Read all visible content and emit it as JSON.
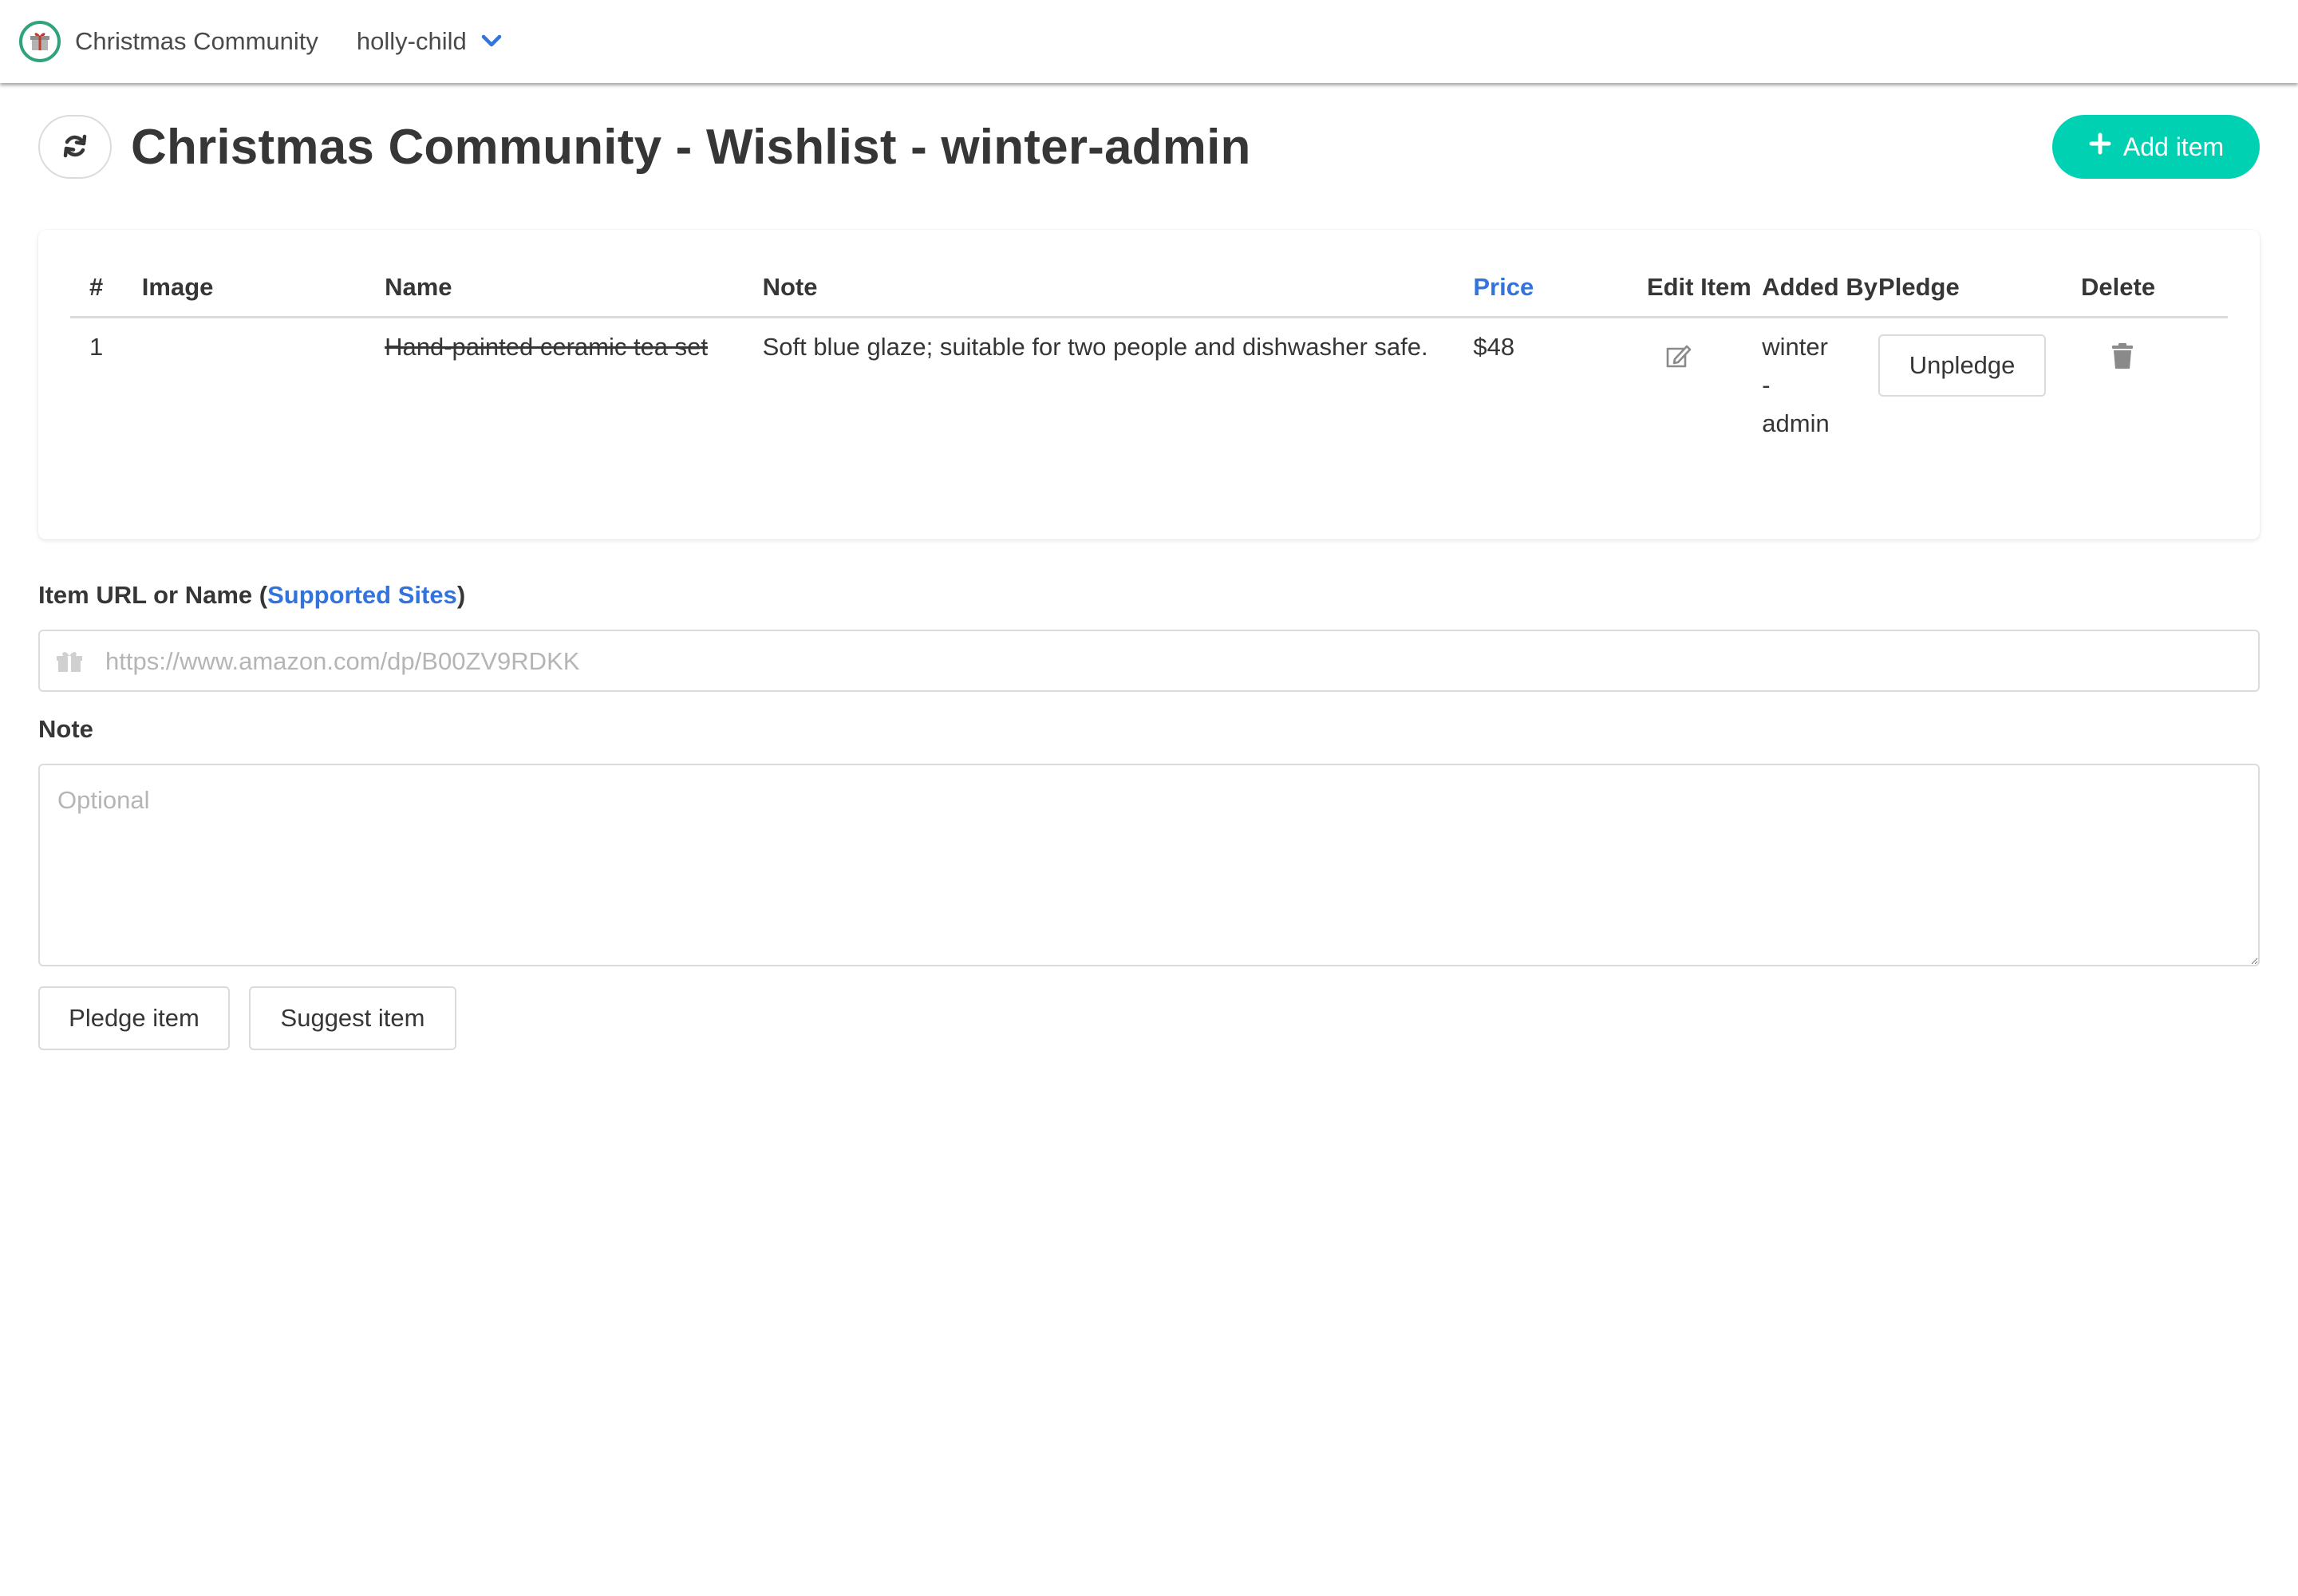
{
  "navbar": {
    "brand": "Christmas Community",
    "user": "holly-child",
    "logo_icon": "gift-icon",
    "menu_icon": "chevron-down-icon"
  },
  "header": {
    "title": "Christmas Community - Wishlist - winter-admin",
    "refresh_icon": "refresh-icon",
    "add_label": "Add item"
  },
  "table": {
    "columns": [
      "#",
      "Image",
      "Name",
      "Note",
      "Price",
      "Edit Item",
      "Added By",
      "Pledge",
      "Delete"
    ],
    "rows": [
      {
        "num": "1",
        "image": "",
        "name": "Hand-painted ceramic tea set",
        "note": "Soft blue glaze; suitable for two people and dishwasher safe.",
        "price": "$48",
        "added_by": "winter - admin",
        "pledge_label": "Unpledge"
      }
    ]
  },
  "form": {
    "url_label": "Item URL or Name (",
    "url_label_link": "Supported Sites",
    "url_label_end": ")",
    "url_placeholder": "https://www.amazon.com/dp/B00ZV9RDKK",
    "url_value": "",
    "note_label": "Note",
    "note_placeholder": "Optional",
    "note_value": "",
    "pledge_button": "Pledge item",
    "suggest_button": "Suggest item"
  },
  "colors": {
    "primary": "#00d1b2",
    "link": "#3273dc",
    "logo_ring": "#2fa37b",
    "text": "#363636",
    "border": "#dbdbdb"
  }
}
